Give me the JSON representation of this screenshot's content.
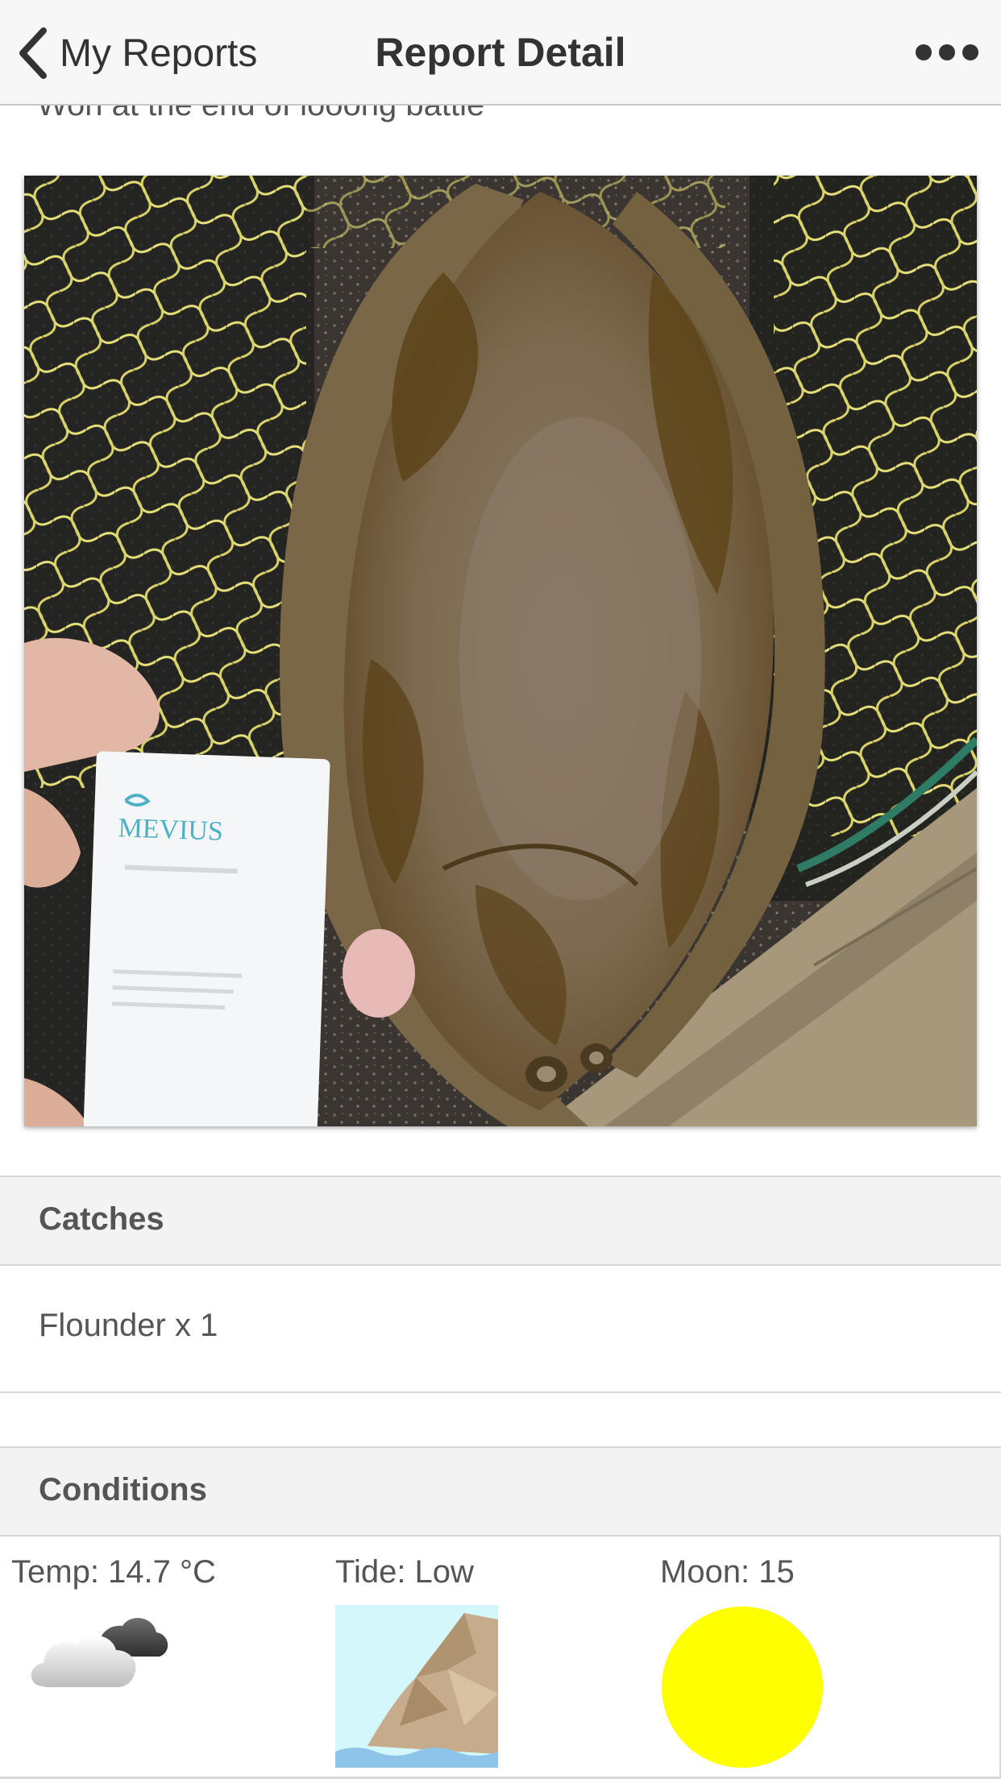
{
  "nav": {
    "back_label": "My Reports",
    "title": "Report Detail"
  },
  "report": {
    "description": "Won at the end of looong battle"
  },
  "catches": {
    "header": "Catches",
    "items": [
      "Flounder x 1"
    ]
  },
  "conditions": {
    "header": "Conditions",
    "temp_label": "Temp: 14.7 °C",
    "tide_label": "Tide: Low",
    "moon_label": "Moon: 15",
    "weather_icon": "cloudy-icon",
    "tide_icon": "low-tide-cliff-icon",
    "moon_icon": "full-moon-icon",
    "moon_color": "#ffff00"
  },
  "photo": {
    "card_text": "MEVIUS"
  },
  "colors": {
    "navbar_bg": "#f7f7f7",
    "header_bg": "#f3f3f3",
    "text": "#555555"
  }
}
